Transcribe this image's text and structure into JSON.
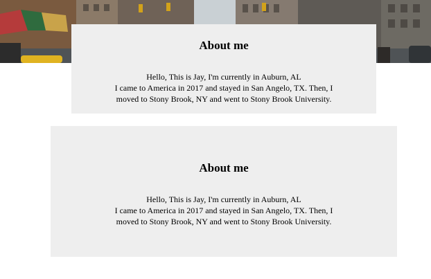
{
  "banner": {
    "alt": "city street photo",
    "colors": {
      "sky": "#b8c2c8",
      "building_left": "#7a5a3f",
      "building_right": "#6d6a63",
      "awning_red": "#b53b3b",
      "awning_green": "#2f6b3e",
      "taxi_yellow": "#e0b321"
    }
  },
  "cards": [
    {
      "title": "About me",
      "line1": "Hello, This is Jay, I'm currently in Auburn, AL",
      "line2": "I came to America in 2017 and stayed in San Angelo, TX. Then, I moved to Stony Brook, NY and went to Stony Brook University."
    },
    {
      "title": "About me",
      "line1": "Hello, This is Jay, I'm currently in Auburn, AL",
      "line2": "I came to America in 2017 and stayed in San Angelo, TX. Then, I moved to Stony Brook, NY and went to Stony Brook University."
    }
  ],
  "colors": {
    "card_background": "#eeeeee",
    "page_background": "#ffffff",
    "text": "#000000"
  }
}
